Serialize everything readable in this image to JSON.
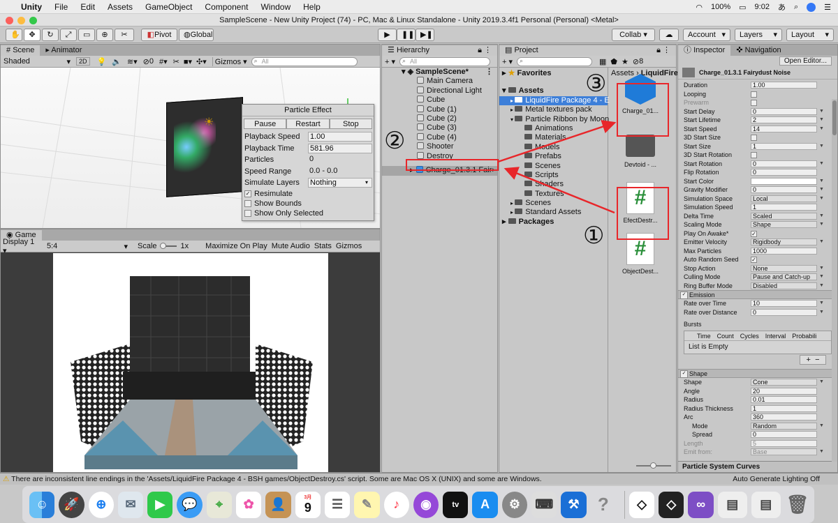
{
  "menubar": {
    "apple": "",
    "app": "Unity",
    "items": [
      "File",
      "Edit",
      "Assets",
      "GameObject",
      "Component",
      "Window",
      "Help"
    ],
    "battery": "100%",
    "time": "9:02",
    "input": "あ"
  },
  "window": {
    "title": "SampleScene - New Unity Project (74) - PC, Mac & Linux Standalone - Unity 2019.3.4f1 Personal (Personal) <Metal>"
  },
  "toolbar": {
    "pivot": "Pivot",
    "global": "Global",
    "collab": "Collab ▾",
    "account": "Account",
    "layers": "Layers",
    "layout": "Layout"
  },
  "scene": {
    "tab": "Scene",
    "tab2": "Animator",
    "shaded": "Shaded",
    "mode2d": "2D",
    "fx_count": "0",
    "gizmos": "Gizmos",
    "search_placeholder": "All"
  },
  "particle_effect": {
    "title": "Particle Effect",
    "buttons": [
      "Pause",
      "Restart",
      "Stop"
    ],
    "rows": [
      {
        "label": "Playback Speed",
        "value": "1.00"
      },
      {
        "label": "Playback Time",
        "value": "581.96"
      },
      {
        "label": "Particles",
        "value": "0"
      },
      {
        "label": "Speed Range",
        "value": "0.0 - 0.0"
      },
      {
        "label": "Simulate Layers",
        "value": "Nothing"
      }
    ],
    "checks": [
      {
        "label": "Resimulate",
        "checked": true
      },
      {
        "label": "Show Bounds",
        "checked": false
      },
      {
        "label": "Show Only Selected",
        "checked": false
      }
    ]
  },
  "game": {
    "tab": "Game",
    "display": "Display 1",
    "aspect": "5:4",
    "scale_label": "Scale",
    "scale_value": "1x",
    "toggles": [
      "Maximize On Play",
      "Mute Audio",
      "Stats",
      "Gizmos"
    ]
  },
  "hierarchy": {
    "tab": "Hierarchy",
    "search_placeholder": "All",
    "scene": "SampleScene*",
    "items": [
      "Main Camera",
      "Directional Light",
      "Cube",
      "Cube (1)",
      "Cube (2)",
      "Cube (3)",
      "Cube (4)",
      "Shooter",
      "Destroy"
    ],
    "selected": "Charge_01.3.1 Fair"
  },
  "project": {
    "tab": "Project",
    "favorites": "Favorites",
    "assets": "Assets",
    "breadcrumb_root": "Assets",
    "breadcrumb_current": "LiquidFire",
    "count": "8",
    "tree": [
      {
        "label": "LiquidFire Package 4 - E",
        "depth": 1,
        "selected": true
      },
      {
        "label": "Metal textures pack",
        "depth": 1
      },
      {
        "label": "Particle Ribbon by Moon",
        "depth": 1
      },
      {
        "label": "Animations",
        "depth": 2
      },
      {
        "label": "Materials",
        "depth": 2
      },
      {
        "label": "Models",
        "depth": 2
      },
      {
        "label": "Prefabs",
        "depth": 2
      },
      {
        "label": "Scenes",
        "depth": 2
      },
      {
        "label": "Scripts",
        "depth": 2
      },
      {
        "label": "Shaders",
        "depth": 2
      },
      {
        "label": "Textures",
        "depth": 2
      },
      {
        "label": "Scenes",
        "depth": 1
      },
      {
        "label": "Standard Assets",
        "depth": 1
      }
    ],
    "packages": "Packages",
    "grid": [
      {
        "label": "Charge_01...",
        "kind": "prefab"
      },
      {
        "label": "Devtoid - ...",
        "kind": "folder"
      },
      {
        "label": "EfectDestr...",
        "kind": "script"
      },
      {
        "label": "ObjectDest...",
        "kind": "script"
      }
    ]
  },
  "annotations": {
    "one": "①",
    "two": "②",
    "three": "③"
  },
  "inspector": {
    "tab": "Inspector",
    "tab2": "Navigation",
    "open_editor": "Open Editor...",
    "object_name": "Charge_01.3.1 Fairydust Noise",
    "rows": [
      {
        "label": "Duration",
        "value": "1.00",
        "t": "f"
      },
      {
        "label": "Looping",
        "value": "",
        "t": "c"
      },
      {
        "label": "Prewarm",
        "value": "",
        "t": "c",
        "dim": true
      },
      {
        "label": "Start Delay",
        "value": "0",
        "t": "fa"
      },
      {
        "label": "Start Lifetime",
        "value": "2",
        "t": "fa"
      },
      {
        "label": "Start Speed",
        "value": "14",
        "t": "fa"
      },
      {
        "label": "3D Start Size",
        "value": "",
        "t": "c"
      },
      {
        "label": "Start Size",
        "value": "1",
        "t": "fa"
      },
      {
        "label": "3D Start Rotation",
        "value": "",
        "t": "c"
      },
      {
        "label": "Start Rotation",
        "value": "0",
        "t": "fa"
      },
      {
        "label": "Flip Rotation",
        "value": "0",
        "t": "f"
      },
      {
        "label": "Start Color",
        "value": "",
        "t": "color"
      },
      {
        "label": "Gravity Modifier",
        "value": "0",
        "t": "fa"
      },
      {
        "label": "Simulation Space",
        "value": "Local",
        "t": "d"
      },
      {
        "label": "Simulation Speed",
        "value": "1",
        "t": "f"
      },
      {
        "label": "Delta Time",
        "value": "Scaled",
        "t": "d"
      },
      {
        "label": "Scaling Mode",
        "value": "Shape",
        "t": "d"
      },
      {
        "label": "Play On Awake*",
        "value": "✓",
        "t": "c"
      },
      {
        "label": "Emitter Velocity",
        "value": "Rigidbody",
        "t": "d"
      },
      {
        "label": "Max Particles",
        "value": "1000",
        "t": "f"
      },
      {
        "label": "Auto Random Seed",
        "value": "✓",
        "t": "c"
      },
      {
        "label": "Stop Action",
        "value": "None",
        "t": "d"
      },
      {
        "label": "Culling Mode",
        "value": "Pause and Catch-up",
        "t": "d"
      },
      {
        "label": "Ring Buffer Mode",
        "value": "Disabled",
        "t": "d"
      }
    ],
    "emission": {
      "title": "Emission",
      "rows": [
        {
          "label": "Rate over Time",
          "value": "10"
        },
        {
          "label": "Rate over Distance",
          "value": "0"
        }
      ],
      "bursts": "Bursts",
      "burst_cols": [
        "Time",
        "Count",
        "Cycles",
        "Interval",
        "Probabili"
      ],
      "empty": "List is Empty"
    },
    "shape": {
      "title": "Shape",
      "rows": [
        {
          "label": "Shape",
          "value": "Cone",
          "t": "d"
        },
        {
          "label": "Angle",
          "value": "20",
          "t": "f"
        },
        {
          "label": "Radius",
          "value": "0.01",
          "t": "f"
        },
        {
          "label": "Radius Thickness",
          "value": "1",
          "t": "f"
        },
        {
          "label": "Arc",
          "value": "360",
          "t": "f"
        },
        {
          "label": "Mode",
          "value": "Random",
          "t": "d",
          "indent": true
        },
        {
          "label": "Spread",
          "value": "0",
          "t": "f",
          "indent": true
        },
        {
          "label": "Length",
          "value": "5",
          "t": "f",
          "dim": true
        },
        {
          "label": "Emit from:",
          "value": "Base",
          "t": "d",
          "dim": true
        }
      ]
    },
    "curves": "Particle System Curves"
  },
  "status": {
    "message": "There are inconsistent line endings in the 'Assets/LiquidFire Package 4 - BSH games/ObjectDestroy.cs' script. Some are Mac OS X (UNIX) and some are Windows.",
    "right": "Auto Generate Lighting Off"
  },
  "dock": {
    "calendar_month": "3月",
    "calendar_day": "9",
    "tv": "tv"
  }
}
